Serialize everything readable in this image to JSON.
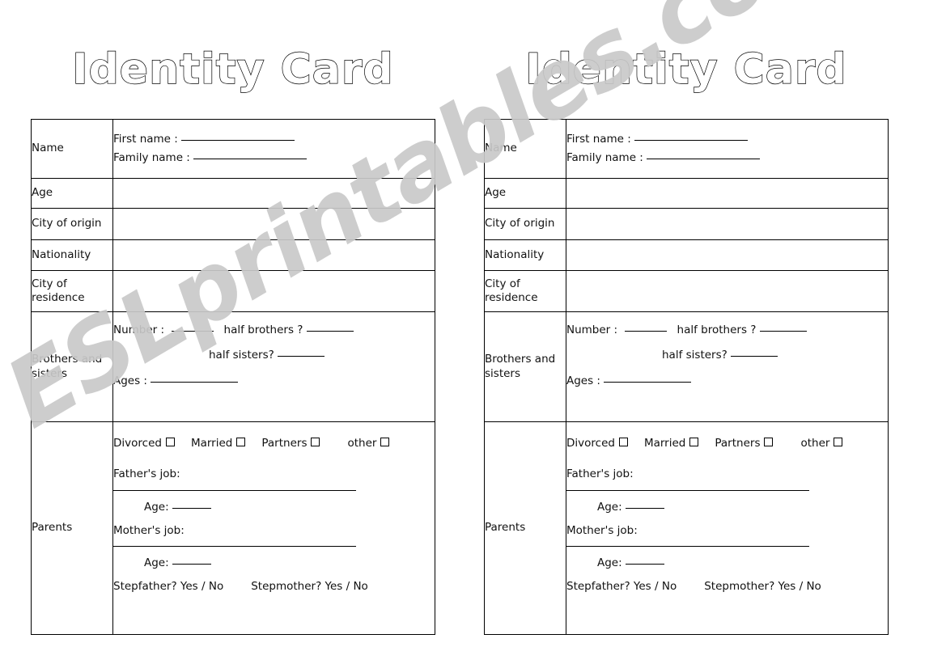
{
  "document": {
    "type": "worksheet",
    "title": "Identity Card",
    "watermark": "ESLprintables.com",
    "background_color": "#ffffff",
    "ink_color": "#000000",
    "watermark_color": "#c9c9c9"
  },
  "card": {
    "title": "Identity Card",
    "rows": [
      {
        "label": "Name",
        "fields": [
          {
            "text": "First name :",
            "rule": true
          },
          {
            "text": "Family name :",
            "rule": true
          }
        ]
      },
      {
        "label": "Age",
        "fields": []
      },
      {
        "label": "City of origin",
        "fields": []
      },
      {
        "label": "Nationality",
        "fields": []
      },
      {
        "label": "City of\nresidence",
        "fields": []
      },
      {
        "label": "Brothers and\nsisters",
        "fields": [
          {
            "text": "Number :",
            "rule": true
          },
          {
            "text": "half brothers ?",
            "rule": true
          },
          {
            "text": "half sisters?",
            "rule": true
          },
          {
            "text": "Ages :",
            "rule": true
          }
        ]
      },
      {
        "label": "Parents",
        "fields": [
          {
            "text": "Divorced",
            "checkbox": true
          },
          {
            "text": "Married",
            "checkbox": true
          },
          {
            "text": "Partners",
            "checkbox": true
          },
          {
            "text": "other",
            "checkbox": true
          },
          {
            "text": "Father's job:",
            "rule": true
          },
          {
            "text": "Age:",
            "rule": true
          },
          {
            "text": "Mother's job:",
            "rule": true
          },
          {
            "text": "Age:",
            "rule": true
          },
          {
            "text": "Stepfather?  Yes / No"
          },
          {
            "text": "Stepmother? Yes / No"
          }
        ]
      }
    ]
  },
  "labels": {
    "name": "Name",
    "age": "Age",
    "city_of_origin": "City of origin",
    "nationality": "Nationality",
    "city_of_residence_line1": "City of",
    "city_of_residence_line2": "residence",
    "brothers_line1": "Brothers and",
    "brothers_line2": "sisters",
    "parents": "Parents"
  },
  "fields": {
    "first_name": "First name :",
    "family_name": "Family name :",
    "number": "Number :",
    "half_brothers": "half brothers ?",
    "half_sisters": "half sisters?",
    "ages": "Ages :",
    "divorced": "Divorced",
    "married": "Married",
    "partners": "Partners",
    "other": "other",
    "fathers_job": "Father's job:",
    "mothers_job": "Mother's job:",
    "father_age": "Age:",
    "mother_age": "Age:",
    "stepfather": "Stepfather?  Yes / No",
    "stepmother": "Stepmother? Yes / No"
  }
}
